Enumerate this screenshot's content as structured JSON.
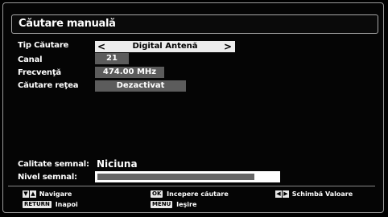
{
  "title": "Căutare manuală",
  "fields": {
    "search_type": {
      "label": "Tip Căutare",
      "value": "Digital Antenă",
      "left_arrow": "<",
      "right_arrow": ">"
    },
    "channel": {
      "label": "Canal",
      "value": "21"
    },
    "frequency": {
      "label": "Frecvenţă",
      "value": "474.00 MHz"
    },
    "network_search": {
      "label": "Căutare reţea",
      "value": "Dezactivat"
    }
  },
  "signal": {
    "quality_label": "Calitate semnal:",
    "quality_value": "Niciuna",
    "level_label": "Nivel semnal:",
    "level_fraction": 0.87
  },
  "footer": {
    "navigate_label": "Navigare",
    "back_key": "RETURN",
    "back_label": "Inapoi",
    "ok_key": "OK",
    "ok_label": "Incepere căutare",
    "menu_key": "MENU",
    "menu_label": "Ieşire",
    "change_label": "Schimbă Valoare"
  }
}
